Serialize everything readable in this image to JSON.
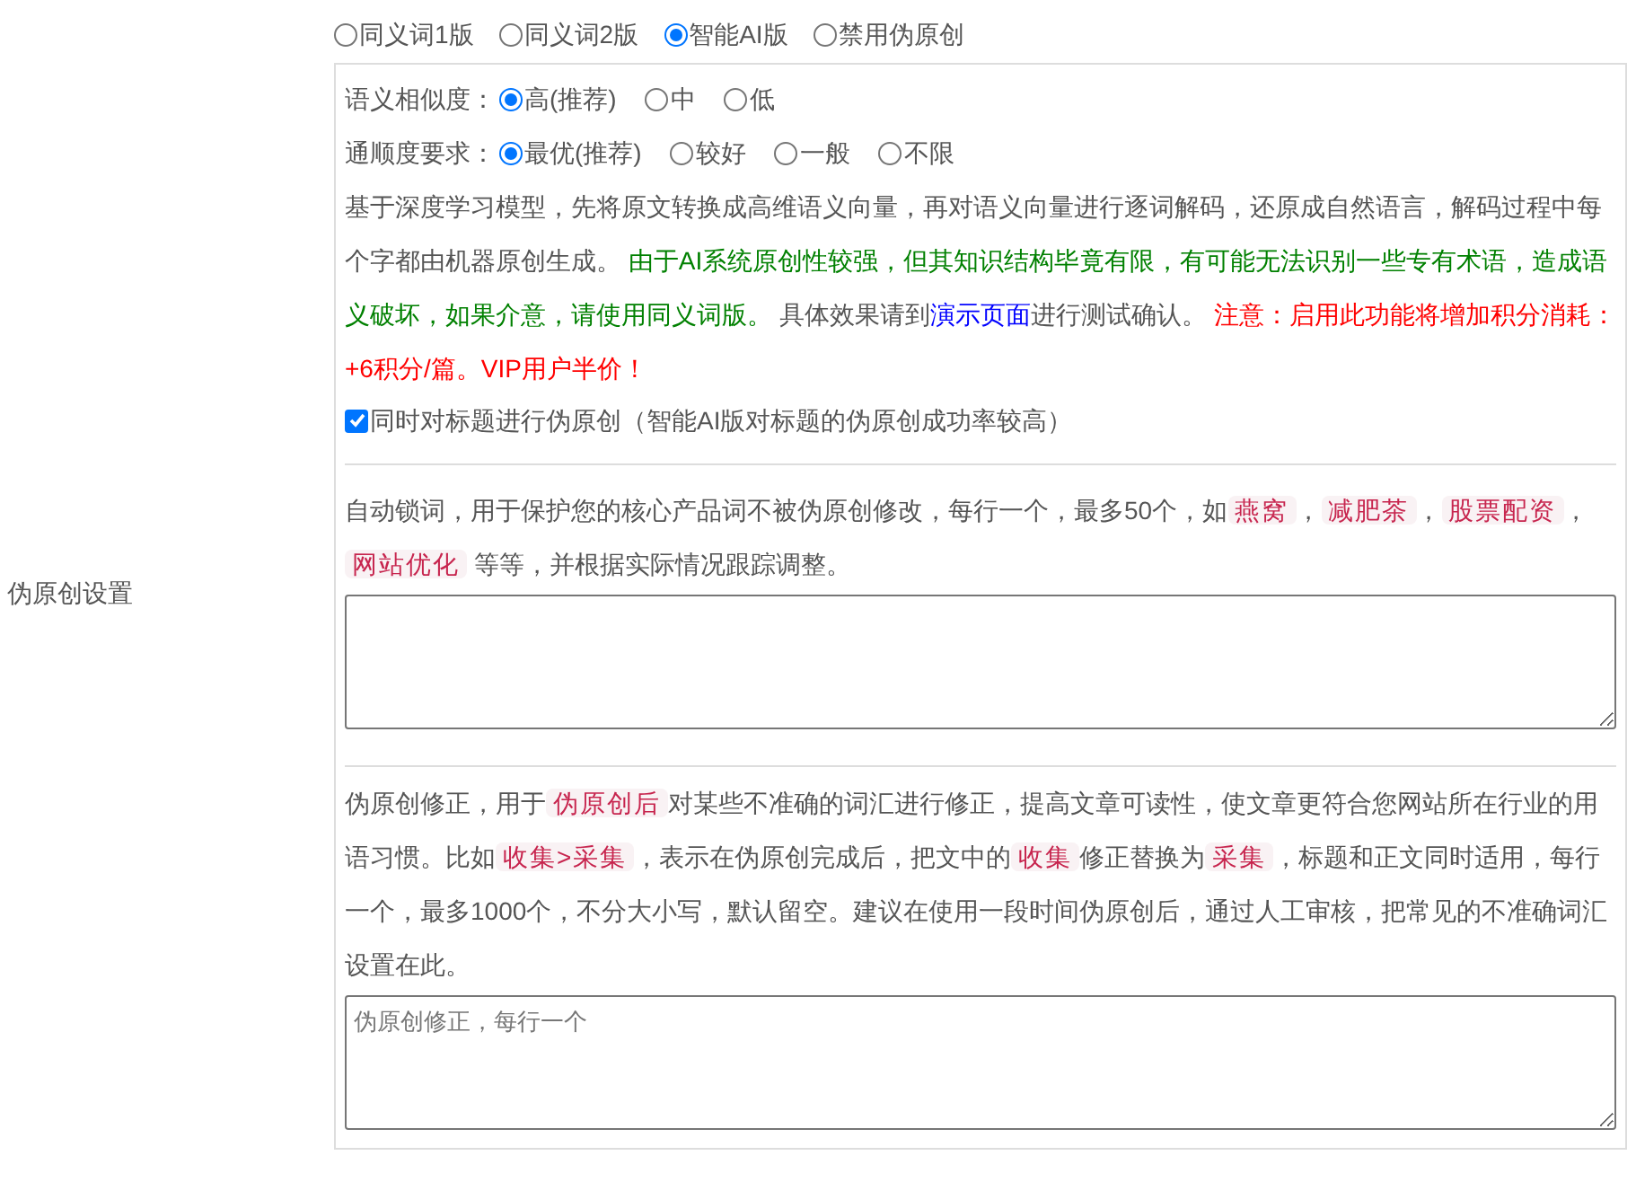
{
  "section_label": "伪原创设置",
  "modes": [
    {
      "label": "同义词1版",
      "selected": false
    },
    {
      "label": "同义词2版",
      "selected": false
    },
    {
      "label": "智能AI版",
      "selected": true
    },
    {
      "label": "禁用伪原创",
      "selected": false
    }
  ],
  "ai_settings": {
    "options": [
      {
        "label": "语义相似度：",
        "choices": [
          {
            "label": "高(推荐)",
            "selected": true
          },
          {
            "label": "中",
            "selected": false
          },
          {
            "label": "低",
            "selected": false
          }
        ]
      },
      {
        "label": "通顺度要求：",
        "choices": [
          {
            "label": "最优(推荐)",
            "selected": true
          },
          {
            "label": "较好",
            "selected": false
          },
          {
            "label": "一般",
            "selected": false
          },
          {
            "label": "不限",
            "selected": false
          }
        ]
      }
    ],
    "description": [
      {
        "kind": "plain",
        "text": "基于深度学习模型，先将原文转换成高维语义向量，再对语义向量进行逐词解码，还原成自然语言，解码过程中每个字都由机器原创生成。 "
      },
      {
        "kind": "green",
        "text": "由于AI系统原创性较强，但其知识结构毕竟有限，有可能无法识别一些专有术语，造成语义破坏，如果介意，请使用同义词版。"
      },
      {
        "kind": "plain",
        "text": " 具体效果请到"
      },
      {
        "kind": "link",
        "text": "演示页面"
      },
      {
        "kind": "plain",
        "text": "进行测试确认。 "
      },
      {
        "kind": "red",
        "text": "注意：启用此功能将增加积分消耗：+6积分/篇。VIP用户半价！"
      }
    ],
    "title_option": {
      "label": "同时对标题进行伪原创（智能AI版对标题的伪原创成功率较高）",
      "checked": true
    }
  },
  "lock_words": {
    "description": [
      {
        "kind": "plain",
        "text": "自动锁词，用于保护您的核心产品词不被伪原创修改，每行一个，最多50个，如"
      },
      {
        "kind": "code",
        "text": "燕窝"
      },
      {
        "kind": "plain",
        "text": "，"
      },
      {
        "kind": "code",
        "text": "减肥茶"
      },
      {
        "kind": "plain",
        "text": "，"
      },
      {
        "kind": "code",
        "text": "股票配资"
      },
      {
        "kind": "plain",
        "text": "，"
      },
      {
        "kind": "code",
        "text": "网站优化"
      },
      {
        "kind": "plain",
        "text": " 等等，并根据实际情况跟踪调整。"
      }
    ]
  },
  "corrections": {
    "description": [
      {
        "kind": "plain",
        "text": "伪原创修正，用于"
      },
      {
        "kind": "code",
        "text": "伪原创后"
      },
      {
        "kind": "plain",
        "text": "对某些不准确的词汇进行修正，提高文章可读性，使文章更符合您网站所在行业的用语习惯。比如"
      },
      {
        "kind": "code",
        "text": "收集>采集"
      },
      {
        "kind": "plain",
        "text": "，表示在伪原创完成后，把文中的"
      },
      {
        "kind": "code",
        "text": "收集"
      },
      {
        "kind": "plain",
        "text": "修正替换为"
      },
      {
        "kind": "code",
        "text": "采集"
      },
      {
        "kind": "plain",
        "text": "，标题和正文同时适用，每行一个，最多1000个，不分大小写，默认留空。建议在使用一段时间伪原创后，通过人工审核，把常见的不准确词汇设置在此。"
      }
    ],
    "placeholder": "伪原创修正，每行一个"
  }
}
